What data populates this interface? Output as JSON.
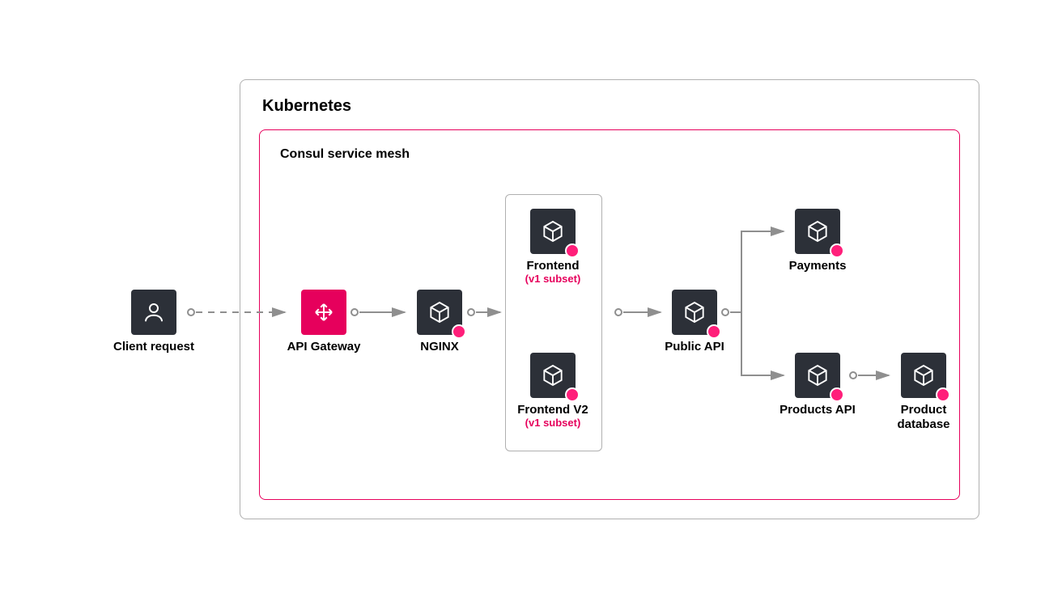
{
  "containers": {
    "kubernetes": {
      "label": "Kubernetes"
    },
    "mesh": {
      "label": "Consul service mesh"
    }
  },
  "nodes": {
    "client": {
      "label": "Client request"
    },
    "gateway": {
      "label": "API Gateway"
    },
    "nginx": {
      "label": "NGINX"
    },
    "frontend": {
      "label": "Frontend",
      "sublabel": "(v1 subset)"
    },
    "frontend2": {
      "label": "Frontend V2",
      "sublabel": "(v1 subset)"
    },
    "publicapi": {
      "label": "Public API"
    },
    "payments": {
      "label": "Payments"
    },
    "productsapi": {
      "label": "Products API"
    },
    "productdb": {
      "label": "Product database"
    }
  },
  "colors": {
    "accent": "#e6005c",
    "dark": "#2c3038",
    "arrow": "#8f8f8f"
  },
  "edges": [
    {
      "from": "client",
      "to": "gateway",
      "style": "dashed"
    },
    {
      "from": "gateway",
      "to": "nginx",
      "style": "solid"
    },
    {
      "from": "nginx",
      "to": "frontend-group",
      "style": "solid"
    },
    {
      "from": "frontend-group",
      "to": "publicapi",
      "style": "solid"
    },
    {
      "from": "publicapi",
      "to": "payments",
      "style": "branch"
    },
    {
      "from": "publicapi",
      "to": "productsapi",
      "style": "branch"
    },
    {
      "from": "productsapi",
      "to": "productdb",
      "style": "solid"
    }
  ]
}
